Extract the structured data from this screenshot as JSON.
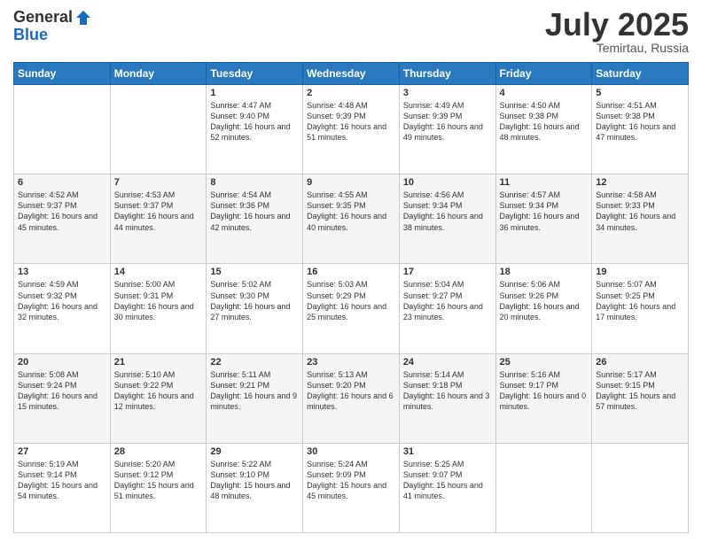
{
  "header": {
    "logo_general": "General",
    "logo_blue": "Blue",
    "month_title": "July 2025",
    "location": "Temirtau, Russia"
  },
  "days_of_week": [
    "Sunday",
    "Monday",
    "Tuesday",
    "Wednesday",
    "Thursday",
    "Friday",
    "Saturday"
  ],
  "weeks": [
    [
      {
        "day": "",
        "info": ""
      },
      {
        "day": "",
        "info": ""
      },
      {
        "day": "1",
        "info": "Sunrise: 4:47 AM\nSunset: 9:40 PM\nDaylight: 16 hours and 52 minutes."
      },
      {
        "day": "2",
        "info": "Sunrise: 4:48 AM\nSunset: 9:39 PM\nDaylight: 16 hours and 51 minutes."
      },
      {
        "day": "3",
        "info": "Sunrise: 4:49 AM\nSunset: 9:39 PM\nDaylight: 16 hours and 49 minutes."
      },
      {
        "day": "4",
        "info": "Sunrise: 4:50 AM\nSunset: 9:38 PM\nDaylight: 16 hours and 48 minutes."
      },
      {
        "day": "5",
        "info": "Sunrise: 4:51 AM\nSunset: 9:38 PM\nDaylight: 16 hours and 47 minutes."
      }
    ],
    [
      {
        "day": "6",
        "info": "Sunrise: 4:52 AM\nSunset: 9:37 PM\nDaylight: 16 hours and 45 minutes."
      },
      {
        "day": "7",
        "info": "Sunrise: 4:53 AM\nSunset: 9:37 PM\nDaylight: 16 hours and 44 minutes."
      },
      {
        "day": "8",
        "info": "Sunrise: 4:54 AM\nSunset: 9:36 PM\nDaylight: 16 hours and 42 minutes."
      },
      {
        "day": "9",
        "info": "Sunrise: 4:55 AM\nSunset: 9:35 PM\nDaylight: 16 hours and 40 minutes."
      },
      {
        "day": "10",
        "info": "Sunrise: 4:56 AM\nSunset: 9:34 PM\nDaylight: 16 hours and 38 minutes."
      },
      {
        "day": "11",
        "info": "Sunrise: 4:57 AM\nSunset: 9:34 PM\nDaylight: 16 hours and 36 minutes."
      },
      {
        "day": "12",
        "info": "Sunrise: 4:58 AM\nSunset: 9:33 PM\nDaylight: 16 hours and 34 minutes."
      }
    ],
    [
      {
        "day": "13",
        "info": "Sunrise: 4:59 AM\nSunset: 9:32 PM\nDaylight: 16 hours and 32 minutes."
      },
      {
        "day": "14",
        "info": "Sunrise: 5:00 AM\nSunset: 9:31 PM\nDaylight: 16 hours and 30 minutes."
      },
      {
        "day": "15",
        "info": "Sunrise: 5:02 AM\nSunset: 9:30 PM\nDaylight: 16 hours and 27 minutes."
      },
      {
        "day": "16",
        "info": "Sunrise: 5:03 AM\nSunset: 9:29 PM\nDaylight: 16 hours and 25 minutes."
      },
      {
        "day": "17",
        "info": "Sunrise: 5:04 AM\nSunset: 9:27 PM\nDaylight: 16 hours and 23 minutes."
      },
      {
        "day": "18",
        "info": "Sunrise: 5:06 AM\nSunset: 9:26 PM\nDaylight: 16 hours and 20 minutes."
      },
      {
        "day": "19",
        "info": "Sunrise: 5:07 AM\nSunset: 9:25 PM\nDaylight: 16 hours and 17 minutes."
      }
    ],
    [
      {
        "day": "20",
        "info": "Sunrise: 5:08 AM\nSunset: 9:24 PM\nDaylight: 16 hours and 15 minutes."
      },
      {
        "day": "21",
        "info": "Sunrise: 5:10 AM\nSunset: 9:22 PM\nDaylight: 16 hours and 12 minutes."
      },
      {
        "day": "22",
        "info": "Sunrise: 5:11 AM\nSunset: 9:21 PM\nDaylight: 16 hours and 9 minutes."
      },
      {
        "day": "23",
        "info": "Sunrise: 5:13 AM\nSunset: 9:20 PM\nDaylight: 16 hours and 6 minutes."
      },
      {
        "day": "24",
        "info": "Sunrise: 5:14 AM\nSunset: 9:18 PM\nDaylight: 16 hours and 3 minutes."
      },
      {
        "day": "25",
        "info": "Sunrise: 5:16 AM\nSunset: 9:17 PM\nDaylight: 16 hours and 0 minutes."
      },
      {
        "day": "26",
        "info": "Sunrise: 5:17 AM\nSunset: 9:15 PM\nDaylight: 15 hours and 57 minutes."
      }
    ],
    [
      {
        "day": "27",
        "info": "Sunrise: 5:19 AM\nSunset: 9:14 PM\nDaylight: 15 hours and 54 minutes."
      },
      {
        "day": "28",
        "info": "Sunrise: 5:20 AM\nSunset: 9:12 PM\nDaylight: 15 hours and 51 minutes."
      },
      {
        "day": "29",
        "info": "Sunrise: 5:22 AM\nSunset: 9:10 PM\nDaylight: 15 hours and 48 minutes."
      },
      {
        "day": "30",
        "info": "Sunrise: 5:24 AM\nSunset: 9:09 PM\nDaylight: 15 hours and 45 minutes."
      },
      {
        "day": "31",
        "info": "Sunrise: 5:25 AM\nSunset: 9:07 PM\nDaylight: 15 hours and 41 minutes."
      },
      {
        "day": "",
        "info": ""
      },
      {
        "day": "",
        "info": ""
      }
    ]
  ]
}
